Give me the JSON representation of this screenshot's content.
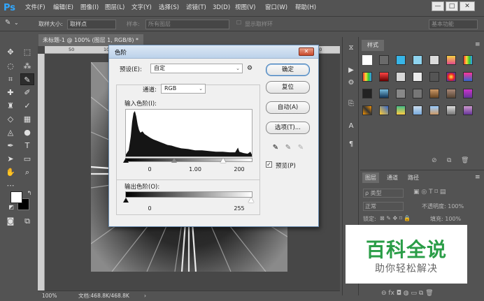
{
  "app": {
    "logo": "Ps"
  },
  "menu": [
    "文件(F)",
    "编辑(E)",
    "图像(I)",
    "图层(L)",
    "文字(Y)",
    "选择(S)",
    "滤镜(T)",
    "3D(D)",
    "视图(V)",
    "窗口(W)",
    "帮助(H)"
  ],
  "window_controls": {
    "minimize": "—",
    "maximize": "□",
    "close": "✕"
  },
  "options_bar": {
    "sample_size_label": "取样大小:",
    "sample_size_value": "取样点",
    "sample_label": "样本:",
    "sample_value": "所有图层",
    "show_ring_label": "显示取样环",
    "workspace": "基本功能"
  },
  "document": {
    "tab_title": "未标题-1 @ 100% (图层 1, RGB/8) *",
    "zoom": "100%",
    "doc_size": "文档:468.8K/468.8K",
    "ruler_top": [
      "50",
      "100",
      "150",
      "200",
      "250",
      "300",
      "350",
      "400",
      "450"
    ]
  },
  "levels": {
    "title": "色阶",
    "preset_label": "预设(E):",
    "preset_value": "自定",
    "channel_label": "通道:",
    "channel_value": "RGB",
    "input_label": "输入色阶(I):",
    "input_black": "0",
    "input_gamma": "1.00",
    "input_white": "200",
    "output_label": "输出色阶(O):",
    "output_black": "0",
    "output_white": "255",
    "btn_ok": "确定",
    "btn_reset": "复位",
    "btn_auto": "自动(A)",
    "btn_options": "选项(T)...",
    "preview_label": "预览(P)",
    "preview_checked": true
  },
  "styles_panel": {
    "tab": "样式"
  },
  "layers_panel": {
    "tabs": [
      "图层",
      "通道",
      "路径"
    ],
    "filter_kind": "ρ 类型",
    "blend_mode": "正常",
    "opacity": "不透明度: 100%",
    "lock_label": "锁定:",
    "fill": "填充: 100%"
  },
  "watermark": {
    "title": "百科全说",
    "subtitle": "助你轻松解决"
  },
  "colors": {
    "accent": "#31a8ff",
    "dialog_border": "#6b8fb5",
    "close_red": "#c94a2c",
    "watermark_green": "#2a9d47"
  }
}
